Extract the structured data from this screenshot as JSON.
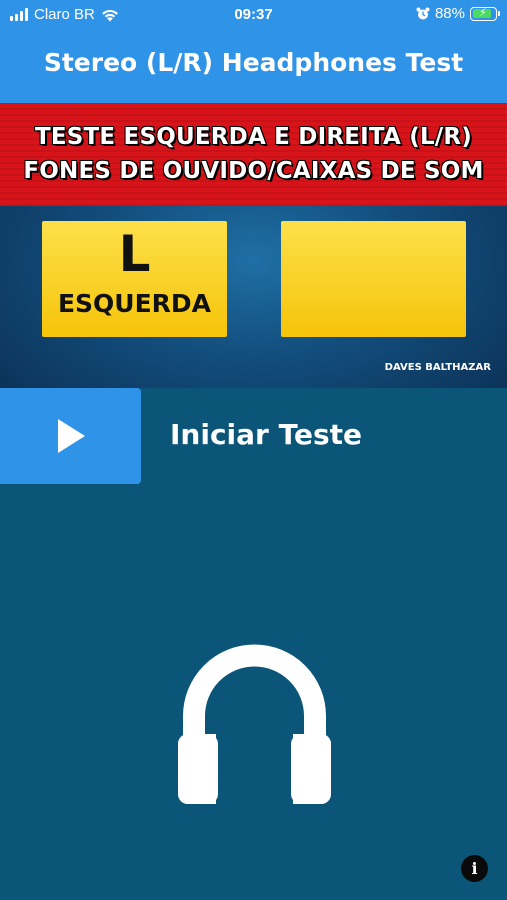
{
  "status_bar": {
    "carrier": "Claro BR",
    "time": "09:37",
    "battery_percent": "88%",
    "battery_level": 0.88,
    "icons": [
      "signal-icon",
      "wifi-icon",
      "alarm-icon",
      "battery-charging-icon"
    ]
  },
  "header": {
    "title": "Stereo (L/R) Headphones Test"
  },
  "video": {
    "banner_line1": "TESTE ESQUERDA E DIREITA (L/R)",
    "banner_line2": "FONES DE OUVIDO/CAIXAS DE SOM",
    "left_panel_letter": "L",
    "left_panel_word": "ESQUERDA",
    "credit": "DAVES BALTHAZAR"
  },
  "controls": {
    "play_icon": "play-icon",
    "start_label": "Iniciar Teste"
  },
  "footer": {
    "headphones_icon": "headphones-icon",
    "info_icon": "info-icon",
    "info_glyph": "i"
  },
  "colors": {
    "accent_blue": "#2f93e8",
    "background": "#0b5579",
    "banner_red": "#d8141a",
    "panel_yellow": "#f6c40a"
  }
}
